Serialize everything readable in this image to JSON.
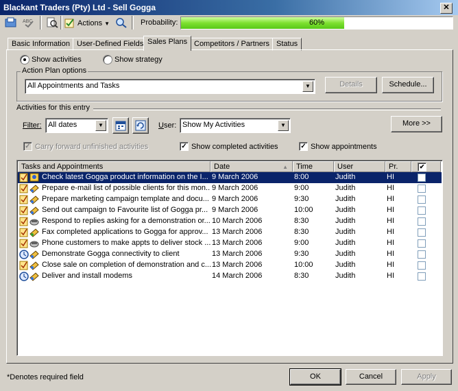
{
  "window": {
    "title": "Blackant Traders (Pty) Ltd - Sell Gogga"
  },
  "toolbar": {
    "actions_label": "Actions",
    "probability_label": "Probability:",
    "probability_text": "60%",
    "probability": 0.6
  },
  "tabs": [
    "Basic Information",
    "User-Defined Fields",
    "Sales Plans",
    "Competitors / Partners",
    "Status"
  ],
  "view": {
    "show_activities": "Show activities",
    "show_strategy": "Show strategy"
  },
  "action_plan": {
    "group_label": "Action Plan options",
    "selected": "All Appointments and Tasks",
    "details_button": "Details",
    "schedule_button": "Schedule..."
  },
  "activities": {
    "group_label": "Activities for this entry",
    "filter_label": "Filter:",
    "filter_value": "All dates",
    "user_label": "User:",
    "user_value": "Show My Activities",
    "more_button": "More >>",
    "carry_forward": "Carry forward unfinished activities",
    "show_completed": "Show completed activities",
    "show_appointments": "Show appointments"
  },
  "grid": {
    "headers": [
      "Tasks and Appointments",
      "Date",
      "Time",
      "User",
      "Pr.",
      "✔"
    ],
    "rows": [
      {
        "task": "Check latest Gogga product information on the I...",
        "date": "9 March 2006",
        "time": "8:00",
        "user": "Judith",
        "pr": "HI",
        "icon": "task-info-icon"
      },
      {
        "task": "Prepare e-mail list of possible clients for this mon...",
        "date": "9 March 2006",
        "time": "9:00",
        "user": "Judith",
        "pr": "HI",
        "icon": "task-email-icon"
      },
      {
        "task": "Prepare marketing campaign template and docu...",
        "date": "9 March 2006",
        "time": "9:30",
        "user": "Judith",
        "pr": "HI",
        "icon": "task-email-icon"
      },
      {
        "task": "Send out campaign to Favourite list of Gogga pr...",
        "date": "9 March 2006",
        "time": "10:00",
        "user": "Judith",
        "pr": "HI",
        "icon": "task-email-icon"
      },
      {
        "task": "Respond to replies asking for a demonstration or...",
        "date": "10 March 2006",
        "time": "8:30",
        "user": "Judith",
        "pr": "HI",
        "icon": "task-phone-icon"
      },
      {
        "task": "Fax completed applications to Gogga for approv...",
        "date": "13 March 2006",
        "time": "8:30",
        "user": "Judith",
        "pr": "HI",
        "icon": "task-fax-icon"
      },
      {
        "task": "Phone customers to make appts to deliver stock ...",
        "date": "13 March 2006",
        "time": "9:00",
        "user": "Judith",
        "pr": "HI",
        "icon": "task-phone-icon"
      },
      {
        "task": "Demonstrate Gogga connectivity to client",
        "date": "13 March 2006",
        "time": "9:30",
        "user": "Judith",
        "pr": "HI",
        "icon": "appointment-clock-icon"
      },
      {
        "task": "Close sale on completion of demonstration and c...",
        "date": "13 March 2006",
        "time": "10:00",
        "user": "Judith",
        "pr": "HI",
        "icon": "task-email-icon"
      },
      {
        "task": "Deliver and install modems",
        "date": "14 March 2006",
        "time": "8:30",
        "user": "Judith",
        "pr": "HI",
        "icon": "appointment-clock-icon"
      }
    ]
  },
  "footer": {
    "required_note": "*Denotes required field",
    "ok": "OK",
    "cancel": "Cancel",
    "apply": "Apply"
  }
}
